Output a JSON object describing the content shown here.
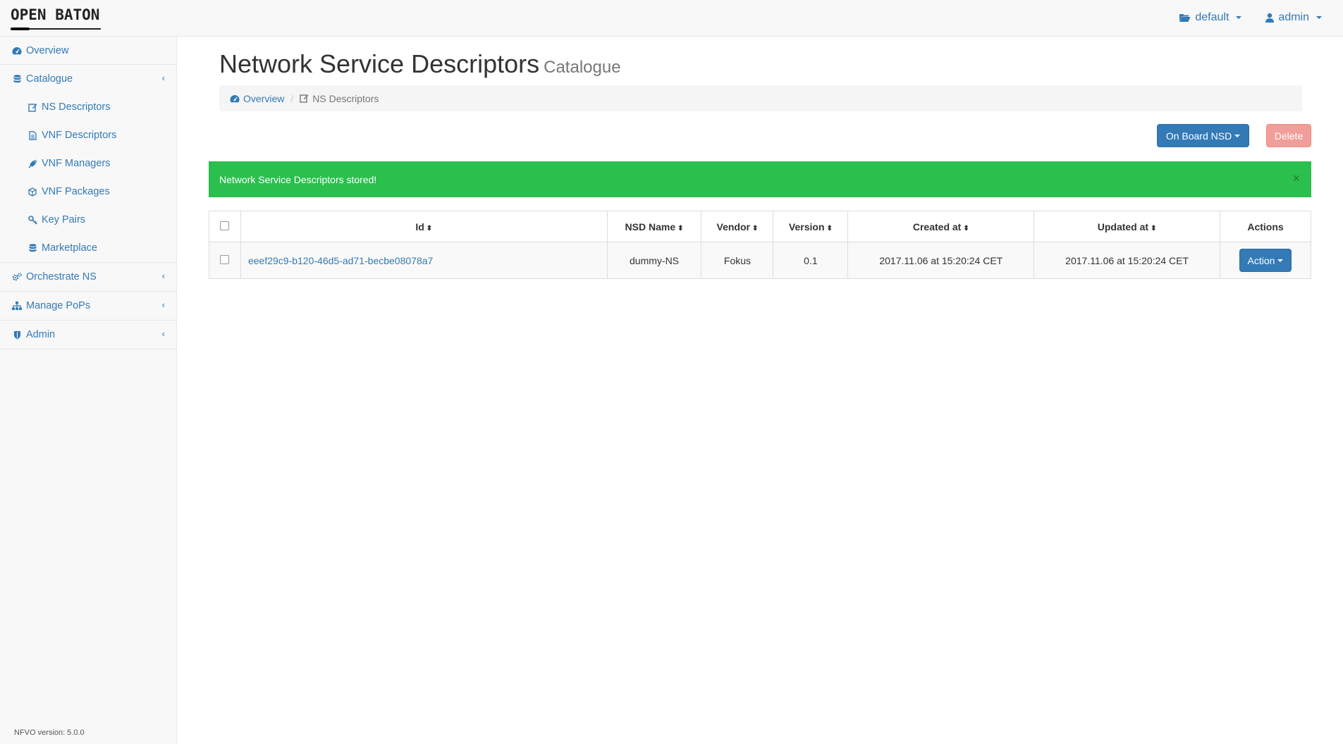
{
  "header": {
    "brand": "OPEN BATON",
    "project_label": "default",
    "user_label": "admin"
  },
  "sidebar": {
    "items": [
      {
        "label": "Overview",
        "icon": "dashboard-icon"
      },
      {
        "label": "Catalogue",
        "icon": "database-icon",
        "expanded": true,
        "children": [
          {
            "label": "NS Descriptors",
            "icon": "edit-icon"
          },
          {
            "label": "VNF Descriptors",
            "icon": "file-icon"
          },
          {
            "label": "VNF Managers",
            "icon": "plug-icon"
          },
          {
            "label": "VNF Packages",
            "icon": "cube-icon"
          },
          {
            "label": "Key Pairs",
            "icon": "key-icon"
          },
          {
            "label": "Marketplace",
            "icon": "database-icon"
          }
        ]
      },
      {
        "label": "Orchestrate NS",
        "icon": "cogs-icon"
      },
      {
        "label": "Manage PoPs",
        "icon": "sitemap-icon"
      },
      {
        "label": "Admin",
        "icon": "shield-icon"
      }
    ],
    "version_text": "NFVO version: 5.0.0"
  },
  "page": {
    "title": "Network Service Descriptors",
    "subtitle": "Catalogue",
    "breadcrumb": {
      "overview": "Overview",
      "current": "NS Descriptors"
    },
    "onboard_label": "On Board NSD",
    "delete_label": "Delete",
    "alert_text": "Network Service Descriptors stored!",
    "alert_close": "×"
  },
  "table": {
    "headers": [
      "Id",
      "NSD Name",
      "Vendor",
      "Version",
      "Created at",
      "Updated at",
      "Actions"
    ],
    "rows": [
      {
        "id": "eeef29c9-b120-46d5-ad71-becbe08078a7",
        "name": "dummy-NS",
        "vendor": "Fokus",
        "version": "0.1",
        "created": "2017.11.06 at 15:20:24 CET",
        "updated": "2017.11.06 at 15:20:24 CET",
        "action_label": "Action"
      }
    ]
  },
  "colors": {
    "primary": "#337ab7",
    "success_alert": "#2bbf4e",
    "danger_disabled": "#f09e99"
  }
}
